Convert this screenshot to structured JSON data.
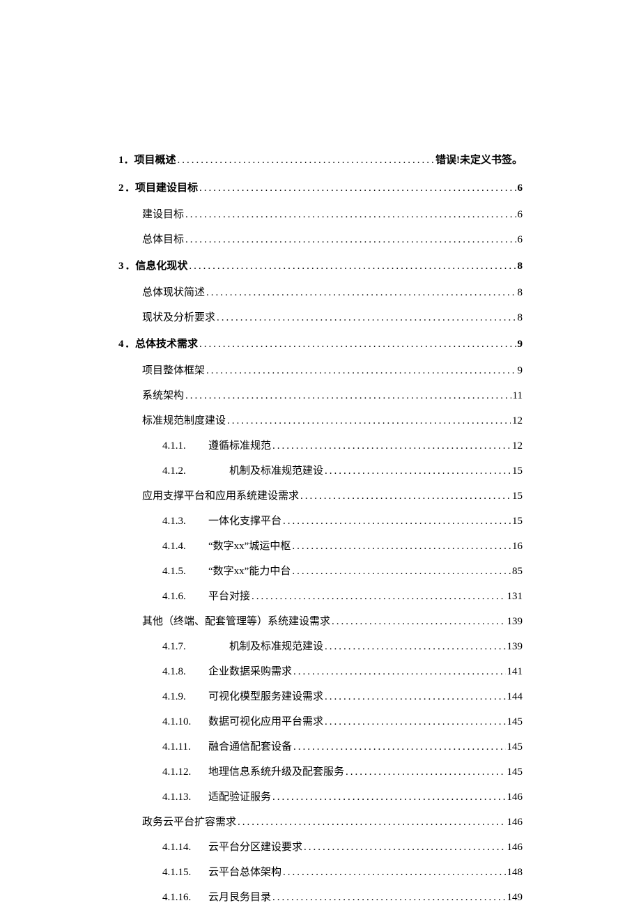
{
  "toc": {
    "entries": [
      {
        "level": 1,
        "num": "1",
        "label": "．项目概述",
        "page": "错误!未定义书签。",
        "err": true
      },
      {
        "level": 1,
        "num": "2",
        "label": "．项目建设目标",
        "page": "6"
      },
      {
        "level": 2,
        "num": "",
        "label": "建设目标",
        "page": "6"
      },
      {
        "level": 2,
        "num": "",
        "label": "总体目标",
        "page": "6"
      },
      {
        "level": 1,
        "num": "3",
        "label": "．信息化现状",
        "page": "8"
      },
      {
        "level": 2,
        "num": "",
        "label": "总体现状简述",
        "page": "8"
      },
      {
        "level": 2,
        "num": "",
        "label": "现状及分析要求",
        "page": "8"
      },
      {
        "level": 1,
        "num": "4",
        "label": "．总体技术需求",
        "page": "9"
      },
      {
        "level": 2,
        "num": "",
        "label": "项目整体框架",
        "page": "9"
      },
      {
        "level": 2,
        "num": "",
        "label": "系统架构",
        "page": "11"
      },
      {
        "level": 2,
        "num": "",
        "label": "标准规范制度建设",
        "page": "12"
      },
      {
        "level": 3,
        "num": "4.1.1.",
        "label": "遵循标准规范",
        "page": "12"
      },
      {
        "level": 3,
        "num": "4.1.2.",
        "label": "　　机制及标准规范建设",
        "page": "15"
      },
      {
        "level": 2,
        "num": "",
        "label": "应用支撑平台和应用系统建设需求",
        "page": "15"
      },
      {
        "level": 3,
        "num": "4.1.3.",
        "label": "一体化支撑平台",
        "page": "15"
      },
      {
        "level": 3,
        "num": "4.1.4.",
        "label": "“数字xx”城运中枢",
        "page": "16"
      },
      {
        "level": 3,
        "num": "4.1.5.",
        "label": "“数字xx”能力中台",
        "page": "85"
      },
      {
        "level": 3,
        "num": "4.1.6.",
        "label": "平台对接",
        "page": "131"
      },
      {
        "level": 2,
        "num": "",
        "label": "其他（终端、配套管理等）系统建设需求",
        "page": "139"
      },
      {
        "level": 3,
        "num": "4.1.7.",
        "label": "　　机制及标准规范建设",
        "page": "139"
      },
      {
        "level": 3,
        "num": "4.1.8.",
        "label": "企业数据采购需求",
        "page": "141"
      },
      {
        "level": 3,
        "num": "4.1.9.",
        "label": "可视化模型服务建设需求",
        "page": "144"
      },
      {
        "level": 3,
        "num": "4.1.10.",
        "label": "数据可视化应用平台需求",
        "page": "145"
      },
      {
        "level": 3,
        "num": "4.1.11.",
        "label": "融合通信配套设备",
        "page": "145"
      },
      {
        "level": 3,
        "num": "4.1.12.",
        "label": "地理信息系统升级及配套服务",
        "page": "145"
      },
      {
        "level": 3,
        "num": "4.1.13.",
        "label": "适配验证服务",
        "page": "146"
      },
      {
        "level": 2,
        "num": "",
        "label": "政务云平台扩容需求",
        "page": "146"
      },
      {
        "level": 3,
        "num": "4.1.14.",
        "label": "云平台分区建设要求",
        "page": "146"
      },
      {
        "level": 3,
        "num": "4.1.15.",
        "label": "云平台总体架构",
        "page": "148"
      },
      {
        "level": 3,
        "num": "4.1.16.",
        "label": "云月艮务目录",
        "page": "149"
      }
    ]
  }
}
